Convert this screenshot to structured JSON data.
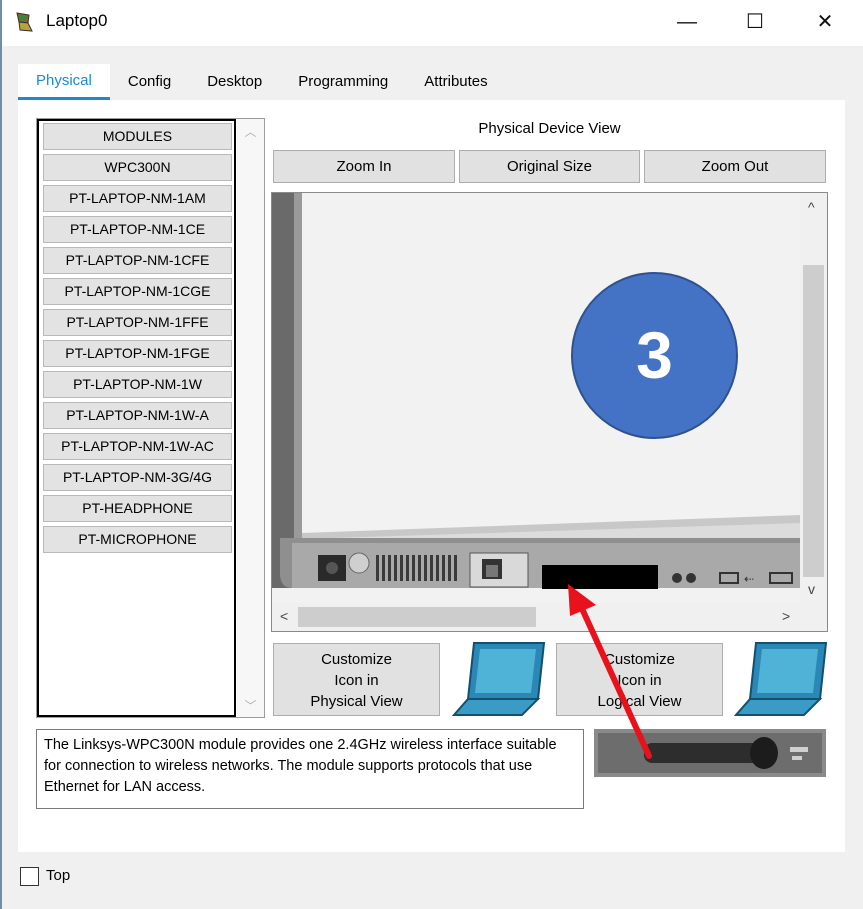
{
  "window": {
    "title": "Laptop0",
    "minimize_glyph": "—",
    "maximize_glyph": "☐",
    "close_glyph": "✕"
  },
  "tabs": [
    {
      "label": "Physical",
      "active": true
    },
    {
      "label": "Config"
    },
    {
      "label": "Desktop"
    },
    {
      "label": "Programming"
    },
    {
      "label": "Attributes"
    }
  ],
  "modules": {
    "items": [
      "MODULES",
      "WPC300N",
      "PT-LAPTOP-NM-1AM",
      "PT-LAPTOP-NM-1CE",
      "PT-LAPTOP-NM-1CFE",
      "PT-LAPTOP-NM-1CGE",
      "PT-LAPTOP-NM-1FFE",
      "PT-LAPTOP-NM-1FGE",
      "PT-LAPTOP-NM-1W",
      "PT-LAPTOP-NM-1W-A",
      "PT-LAPTOP-NM-1W-AC",
      "PT-LAPTOP-NM-3G/4G",
      "PT-HEADPHONE",
      "PT-MICROPHONE"
    ]
  },
  "physical_view": {
    "title": "Physical Device View",
    "zoom_in": "Zoom In",
    "original_size": "Original Size",
    "zoom_out": "Zoom Out"
  },
  "annotation": {
    "badge_number": "3",
    "accent_color": "#4472c4",
    "arrow_color": "#e8121c"
  },
  "customize": {
    "physical_line1": "Customize",
    "physical_line2": "Icon in",
    "physical_line3": "Physical View",
    "logical_line1": "Customize",
    "logical_line2": "Icon in",
    "logical_line3": "Logical View"
  },
  "description": "The Linksys-WPC300N module provides one 2.4GHz wireless interface suitable for connection to wireless networks. The module supports protocols that use Ethernet for LAN access.",
  "footer": {
    "top_label": "Top",
    "top_checked": false
  }
}
